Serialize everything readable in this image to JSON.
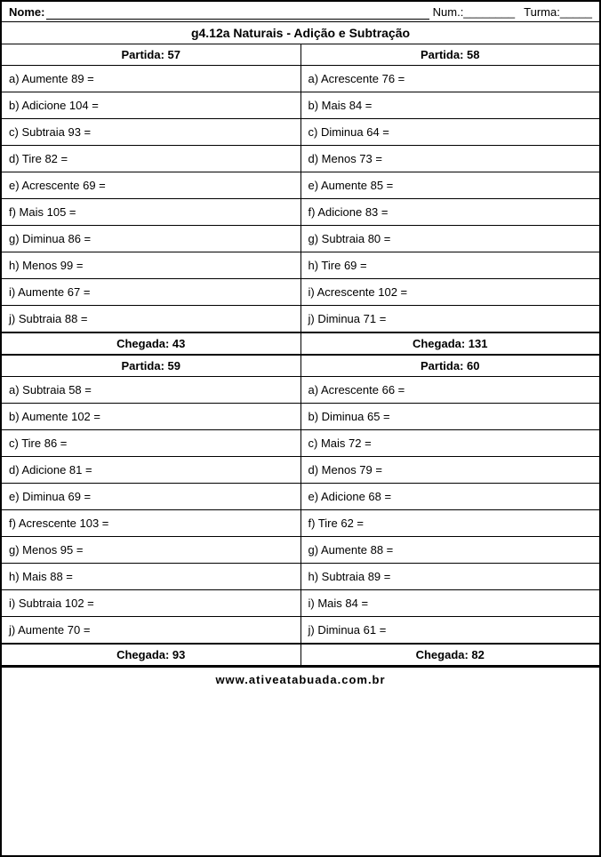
{
  "header": {
    "nome_label": "Nome:",
    "nome_underline": "______________________________________",
    "num_label": "Num.:________",
    "turma_label": "Turma:_____"
  },
  "title": "g4.12a Naturais - Adição e Subtração",
  "section_pairs": [
    {
      "left": {
        "partida": "Partida:  57",
        "chegada": "Chegada:  43",
        "exercises": [
          "a) Aumente 89 =",
          "b) Adicione 104 =",
          "c) Subtraia 93 =",
          "d) Tire 82 =",
          "e) Acrescente 69 =",
          "f) Mais 105 =",
          "g) Diminua 86 =",
          "h) Menos 99 =",
          "i) Aumente 67 =",
          "j) Subtraia 88 ="
        ]
      },
      "right": {
        "partida": "Partida:  58",
        "chegada": "Chegada:  131",
        "exercises": [
          "a) Acrescente 76 =",
          "b) Mais 84 =",
          "c) Diminua 64 =",
          "d) Menos 73 =",
          "e) Aumente 85 =",
          "f) Adicione 83 =",
          "g) Subtraia 80 =",
          "h) Tire 69 =",
          "i) Acrescente 102 =",
          "j) Diminua 71 ="
        ]
      }
    },
    {
      "left": {
        "partida": "Partida:  59",
        "chegada": "Chegada:  93",
        "exercises": [
          "a) Subtraia 58 =",
          "b) Aumente 102 =",
          "c) Tire 86 =",
          "d) Adicione 81 =",
          "e) Diminua 69 =",
          "f) Acrescente 103 =",
          "g) Menos 95 =",
          "h) Mais 88 =",
          "i) Subtraia 102 =",
          "j) Aumente 70 ="
        ]
      },
      "right": {
        "partida": "Partida:  60",
        "chegada": "Chegada:  82",
        "exercises": [
          "a) Acrescente 66 =",
          "b) Diminua 65 =",
          "c) Mais 72 =",
          "d) Menos 79 =",
          "e) Adicione 68 =",
          "f) Tire 62 =",
          "g) Aumente 88 =",
          "h) Subtraia 89 =",
          "i) Mais 84 =",
          "j) Diminua 61 ="
        ]
      }
    }
  ],
  "footer": "www.ativeatabuada.com.br"
}
